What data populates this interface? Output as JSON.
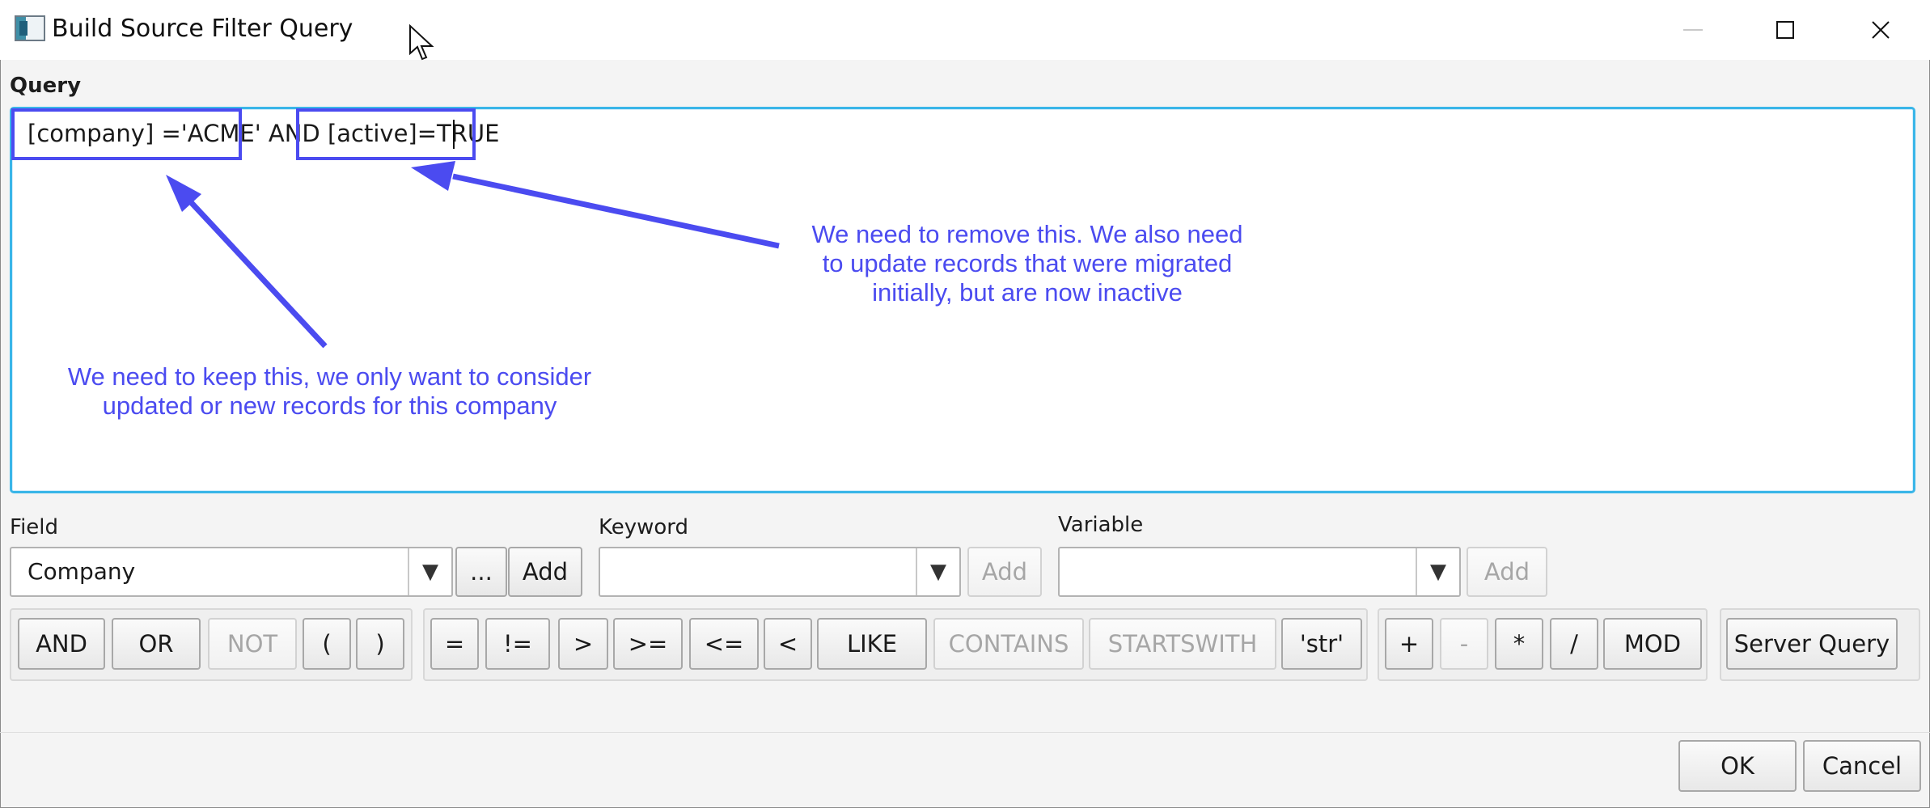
{
  "window": {
    "title": "Build Source Filter Query"
  },
  "query": {
    "label": "Query",
    "text": "[company] ='ACME' AND [active]=TRUE"
  },
  "annotations": {
    "remove_note": "We need to remove this. We also need\nto update records that were migrated\ninitially, but are now inactive",
    "keep_note": "We need to keep this, we only want to consider\nupdated or new records for this company"
  },
  "field": {
    "label": "Field",
    "value": "Company",
    "more_label": "...",
    "add_label": "Add"
  },
  "keyword": {
    "label": "Keyword",
    "value": "",
    "add_label": "Add"
  },
  "variable": {
    "label": "Variable",
    "value": "",
    "add_label": "Add"
  },
  "logic_ops": [
    "AND",
    "OR",
    "NOT",
    "(",
    ")"
  ],
  "compare_ops": [
    "=",
    "!=",
    ">",
    ">=",
    "<=",
    "<",
    "LIKE",
    "CONTAINS",
    "STARTSWITH",
    "'str'"
  ],
  "math_ops": [
    "+",
    "-",
    "*",
    "/",
    "MOD"
  ],
  "server_query_label": "Server Query",
  "footer": {
    "ok_label": "OK",
    "cancel_label": "Cancel"
  },
  "colors": {
    "annotation_blue": "#4b4bf0",
    "focus_blue": "#39b5e8"
  },
  "icons": [
    "app-icon",
    "mouse-cursor-icon",
    "minimize-icon",
    "maximize-icon",
    "close-icon",
    "chevron-down-icon",
    "arrow-icon"
  ]
}
